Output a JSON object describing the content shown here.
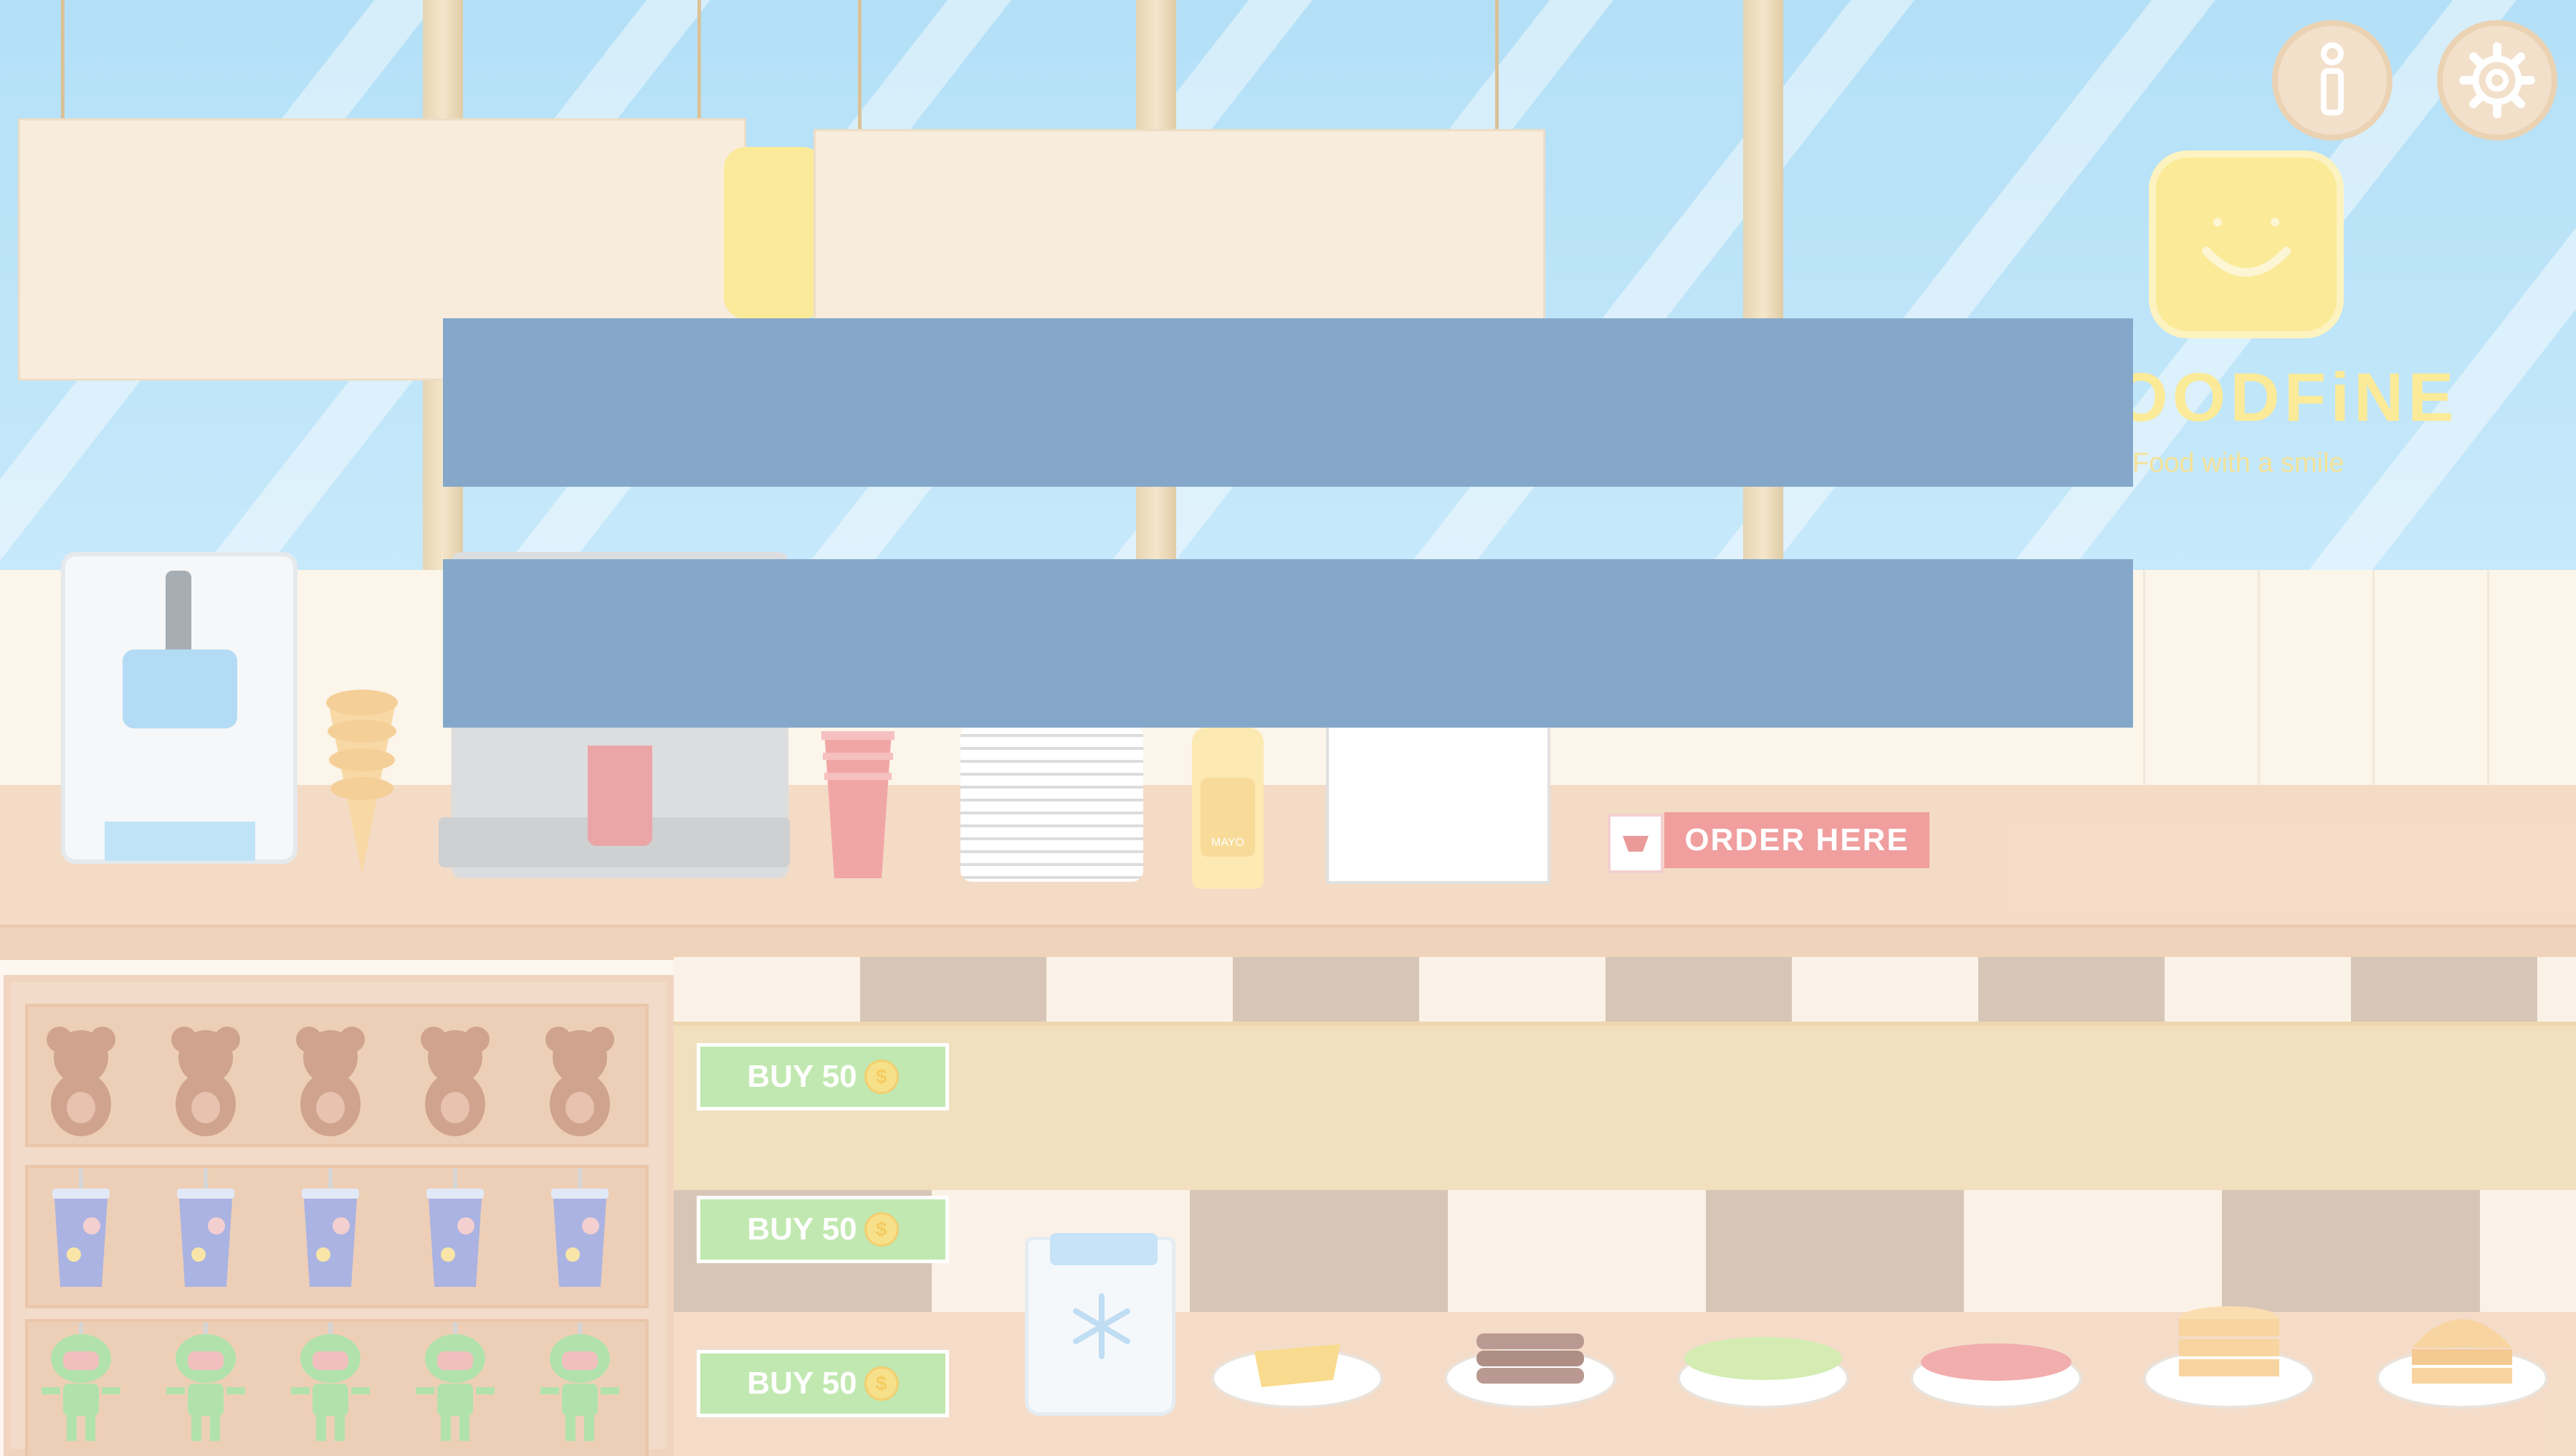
{
  "game": {
    "brand": {
      "name": "OODFiNE",
      "tagline": "Food with a smile"
    },
    "toolbar": {
      "info_icon": "info-icon",
      "settings_icon": "gear-icon"
    },
    "counter": {
      "order_label": "ORDER HERE",
      "mayo_label": "MAYO"
    },
    "shop": {
      "rows": [
        {
          "item": "teddy-bear",
          "count": 5,
          "buy_label": "BUY 50"
        },
        {
          "item": "drink-cup",
          "count": 5,
          "buy_label": "BUY 50"
        },
        {
          "item": "robot",
          "count": 5,
          "buy_label": "BUY 50"
        }
      ],
      "coin_symbol": "$"
    },
    "ingredients": [
      "cheese-slices",
      "beef-patties",
      "lettuce",
      "tomato-slices",
      "pancake-buns",
      "burger-bun"
    ],
    "colors": {
      "overlay": "#759cc3",
      "sky": "#a9dcf6",
      "buy_button": "#b9e5a6",
      "order_button": "#ee9191",
      "logo": "#fbe78a"
    }
  }
}
